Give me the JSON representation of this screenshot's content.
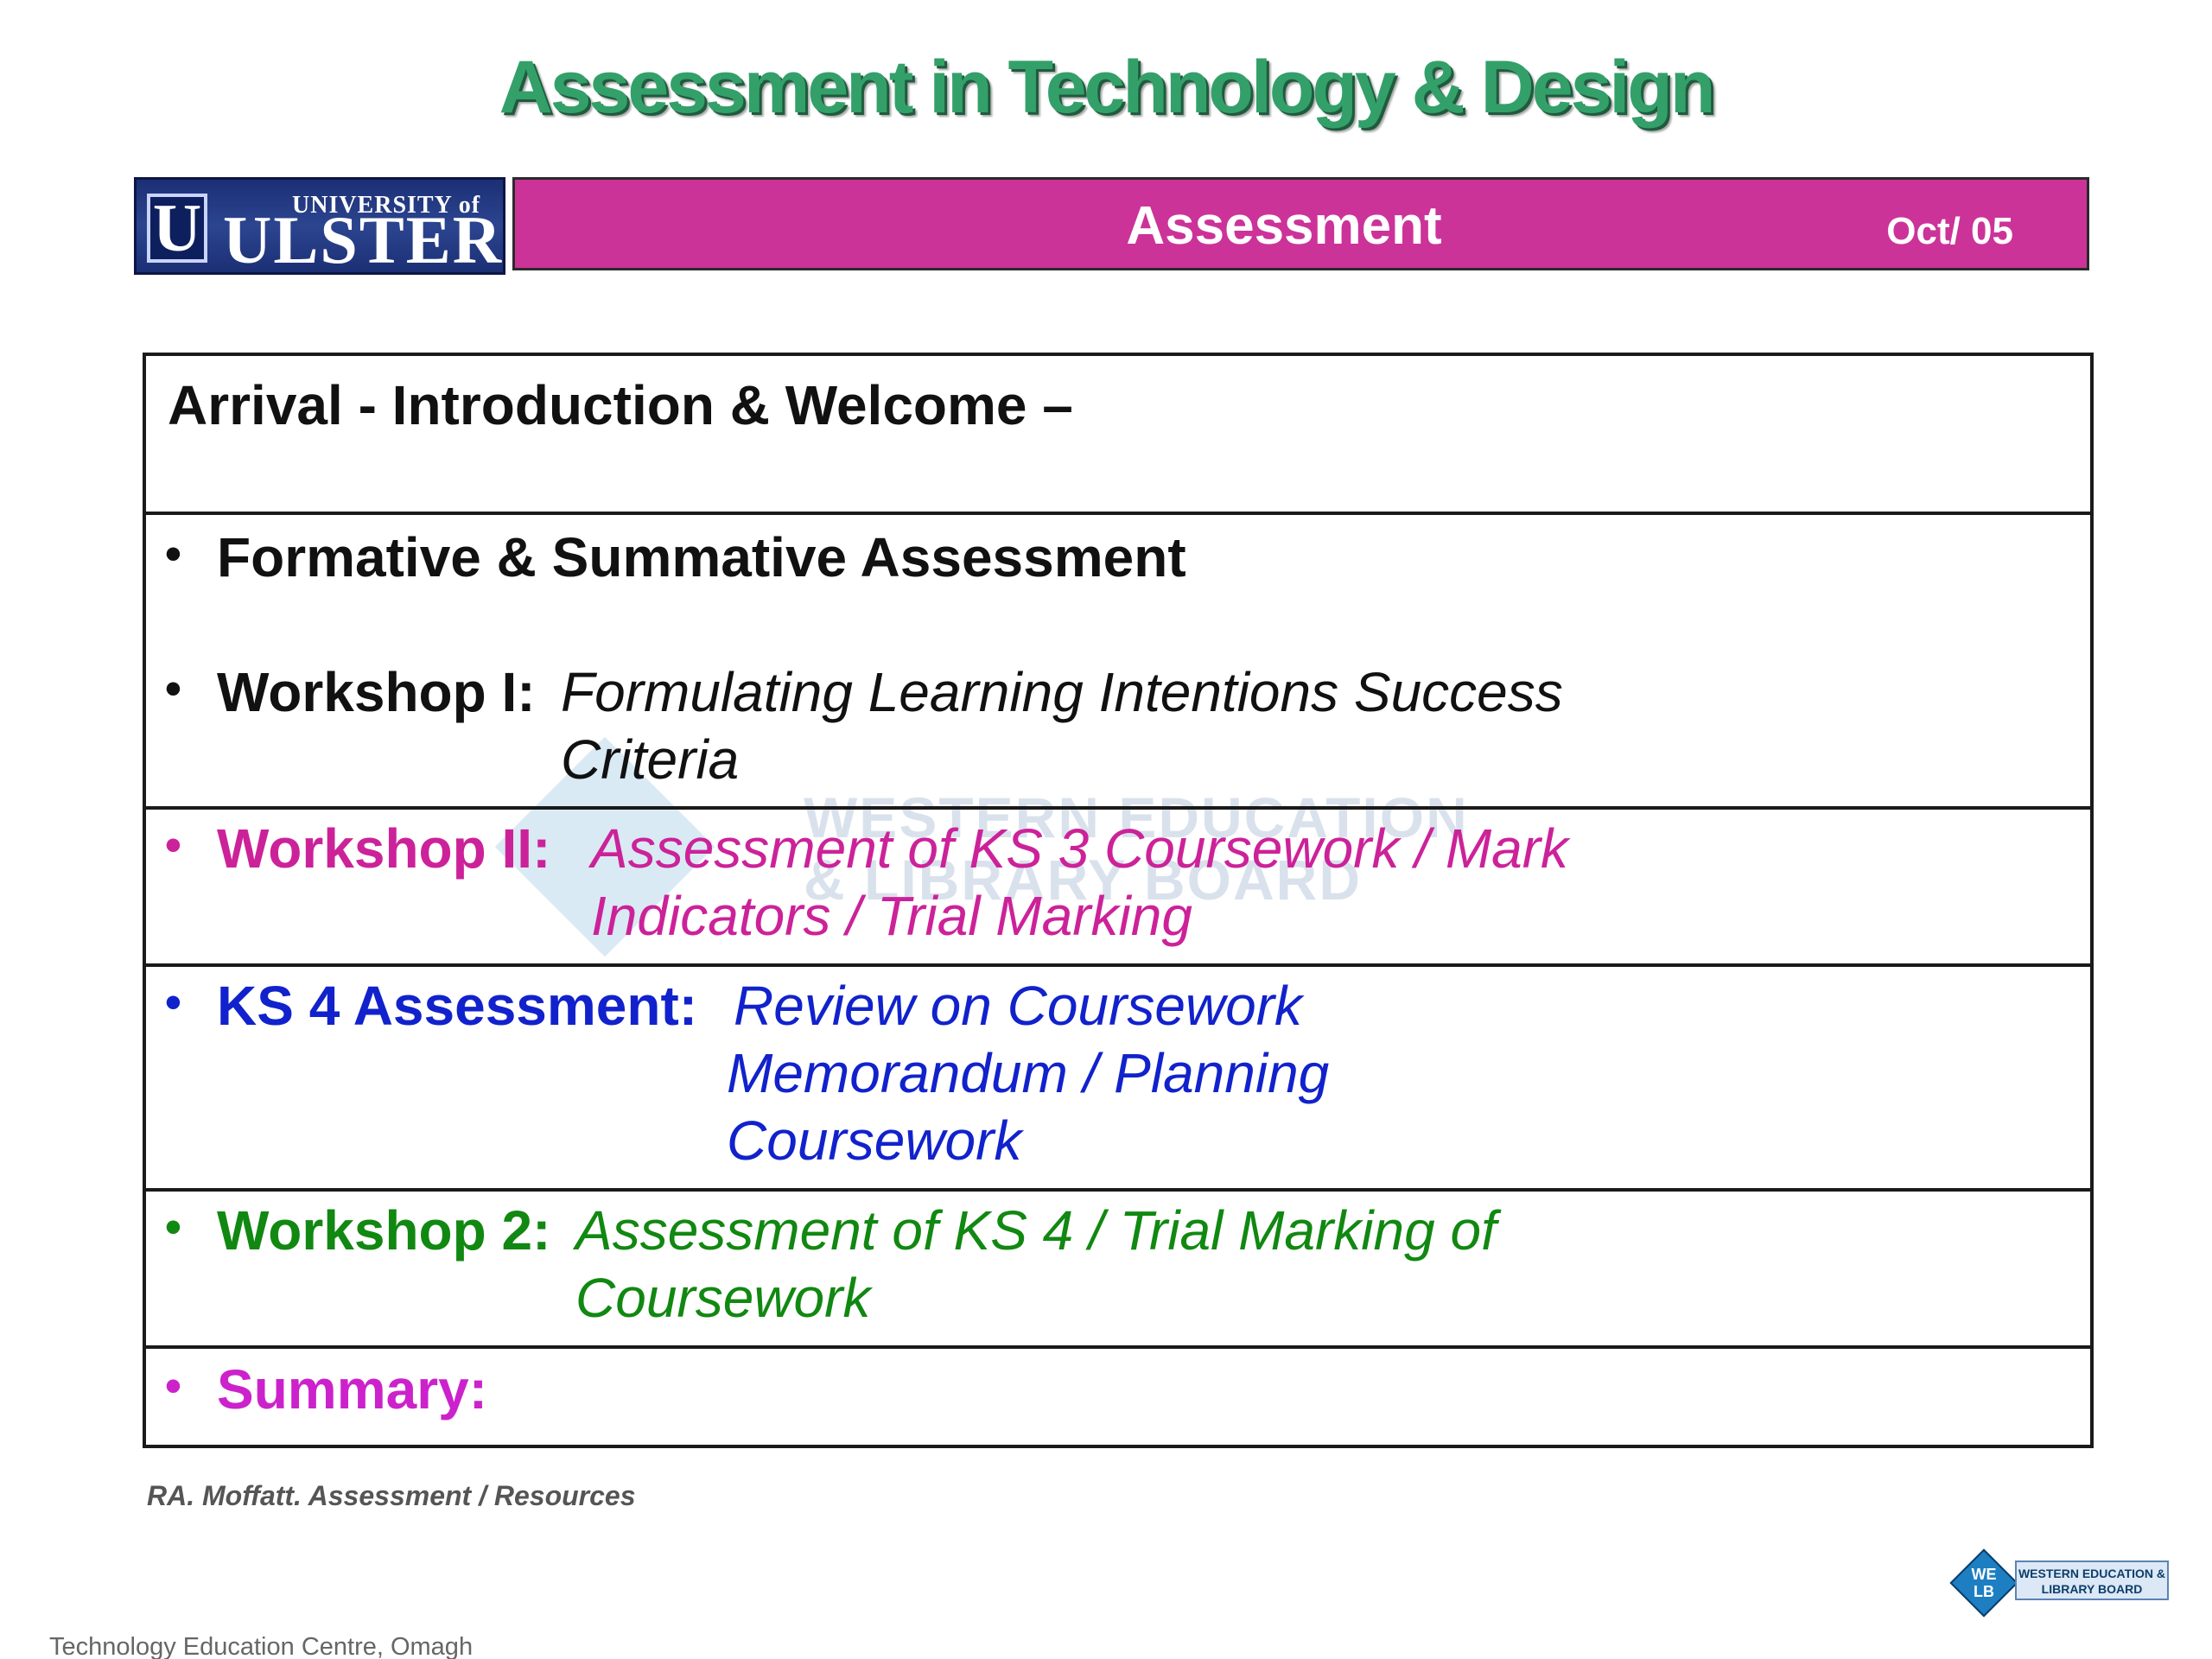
{
  "slide": {
    "title": "Assessment in Technology & Design",
    "banner": {
      "title": "Assessment",
      "date": "Oct/ 05"
    },
    "logos": {
      "ulster": {
        "initial": "U",
        "top_text": "UNIVERSITY of",
        "main_text": "ULSTER"
      },
      "welb": {
        "initials_top": "WE",
        "initials_bottom": "LB",
        "name": "WESTERN EDUCATION & LIBRARY BOARD"
      }
    },
    "watermark": {
      "initials": "WE LB",
      "line1": "WESTERN EDUCATION",
      "line2": "& LIBRARY BOARD"
    },
    "agenda": {
      "arrival": "Arrival - Introduction & Welcome –",
      "formative": {
        "bullet": "•",
        "label": "Formative & Summative Assessment"
      },
      "workshop1": {
        "bullet": "•",
        "label": "Workshop I:",
        "line1": "Formulating  Learning Intentions Success",
        "line2": "Criteria"
      },
      "workshop2": {
        "bullet": "•",
        "label": "Workshop II:",
        "line1": "Assessment of KS 3 Coursework / Mark",
        "line2": "Indicators / Trial Marking"
      },
      "ks4": {
        "bullet": "•",
        "label": "KS 4 Assessment:",
        "line1": "Review on Coursework",
        "line2": "Memorandum / Planning",
        "line3": "Coursework"
      },
      "workshop_2": {
        "bullet": "•",
        "label": "Workshop 2:",
        "line1": "Assessment of KS 4 / Trial Marking of",
        "line2": "Coursework"
      },
      "summary": {
        "bullet": "•",
        "label": "Summary:"
      }
    },
    "colors": {
      "title": "#33a06a",
      "banner": "#cc3399",
      "workshop2": "#cc2299",
      "ks4": "#1122cc",
      "workshop_2": "#118811",
      "summary": "#cc22cc"
    },
    "footer": {
      "credit": "RA. Moffatt. Assessment / Resources",
      "centre": "Technology Education Centre, Omagh"
    }
  }
}
